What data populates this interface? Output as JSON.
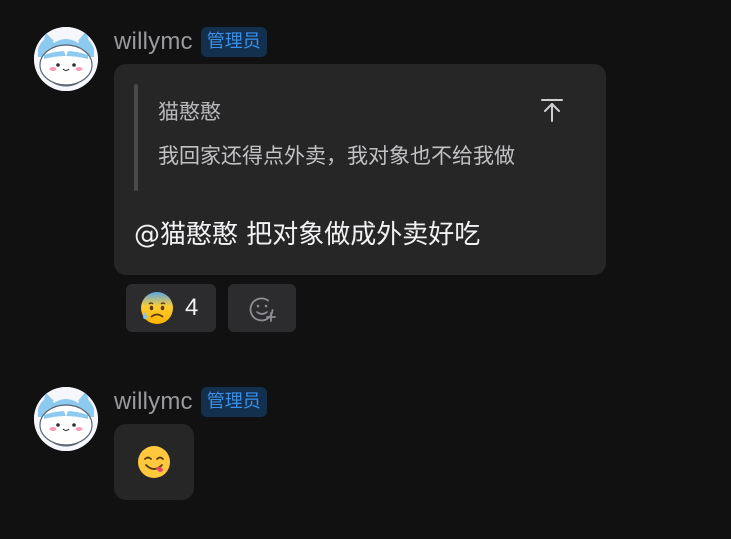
{
  "messages": [
    {
      "username": "willymc",
      "role": "管理员",
      "quote": {
        "author": "猫憨憨",
        "text": "我回家还得点外卖，我对象也不给我做"
      },
      "text": "@猫憨憨 把对象做成外卖好吃",
      "reactions": [
        {
          "emoji_icon": "anxious-sweat-face-icon",
          "count": "4"
        }
      ],
      "add_reaction_icon": "add-reaction-icon"
    },
    {
      "username": "willymc",
      "role": "管理员",
      "emoji_icon": "face-savoring-food-icon"
    }
  ],
  "colors": {
    "background": "#111112",
    "bubble": "#262627",
    "badge_bg": "#13304f",
    "badge_text": "#3d8fe6",
    "username": "#9a9a9e"
  }
}
